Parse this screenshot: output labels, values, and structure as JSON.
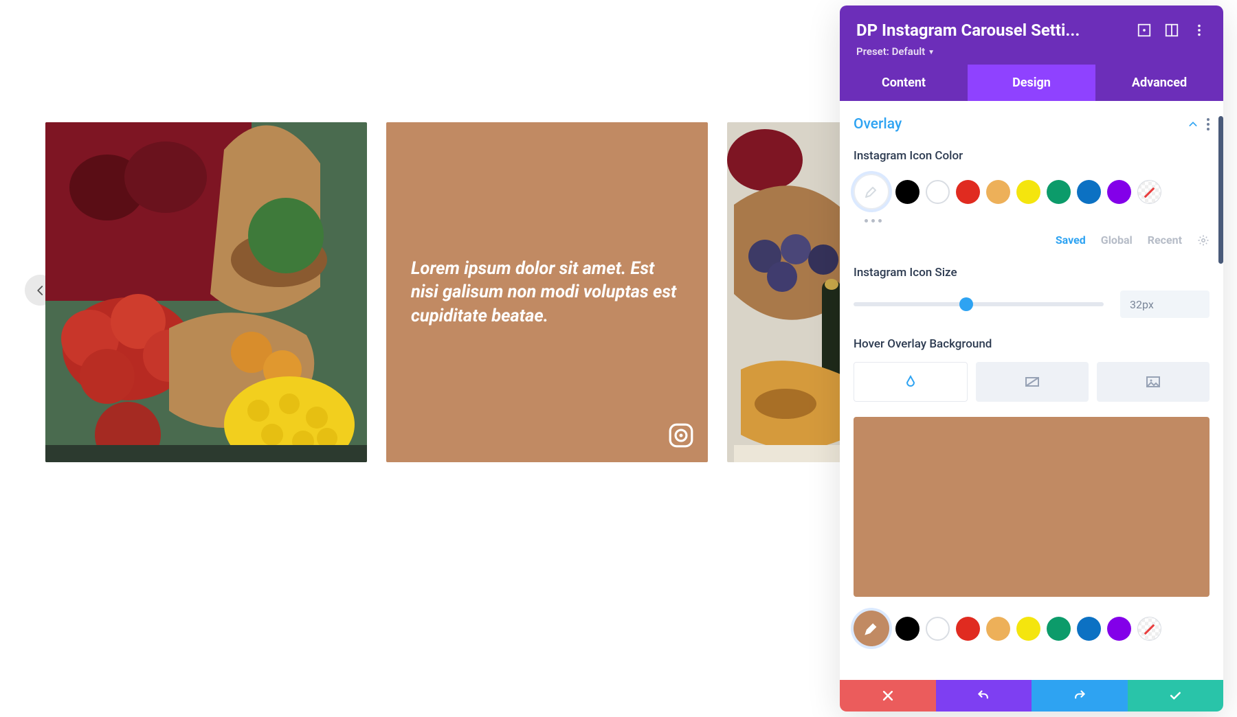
{
  "carousel": {
    "caption": "Lorem ipsum dolor sit amet. Est nisi galisum non modi voluptas est cupiditate beatae.",
    "overlay_color": "#c18a63"
  },
  "panel": {
    "title": "DP Instagram Carousel Setti...",
    "preset_label": "Preset: Default",
    "tabs": {
      "content": "Content",
      "design": "Design",
      "advanced": "Advanced"
    },
    "section": {
      "title": "Overlay",
      "icon_color_label": "Instagram Icon Color",
      "icon_size_label": "Instagram Icon Size",
      "icon_size_value": "32px",
      "hover_bg_label": "Hover Overlay Background",
      "palette_tabs": {
        "saved": "Saved",
        "global": "Global",
        "recent": "Recent"
      },
      "swatches1": [
        "#000000",
        "#ffffff",
        "#e02b20",
        "#edb059",
        "#f4e50e",
        "#0c9b6a",
        "#0c71c3",
        "#8300e9",
        "none"
      ],
      "swatches2": [
        "#000000",
        "#ffffff",
        "#e02b20",
        "#edb059",
        "#f4e50e",
        "#0c9b6a",
        "#0c71c3",
        "#8300e9",
        "none"
      ]
    }
  }
}
